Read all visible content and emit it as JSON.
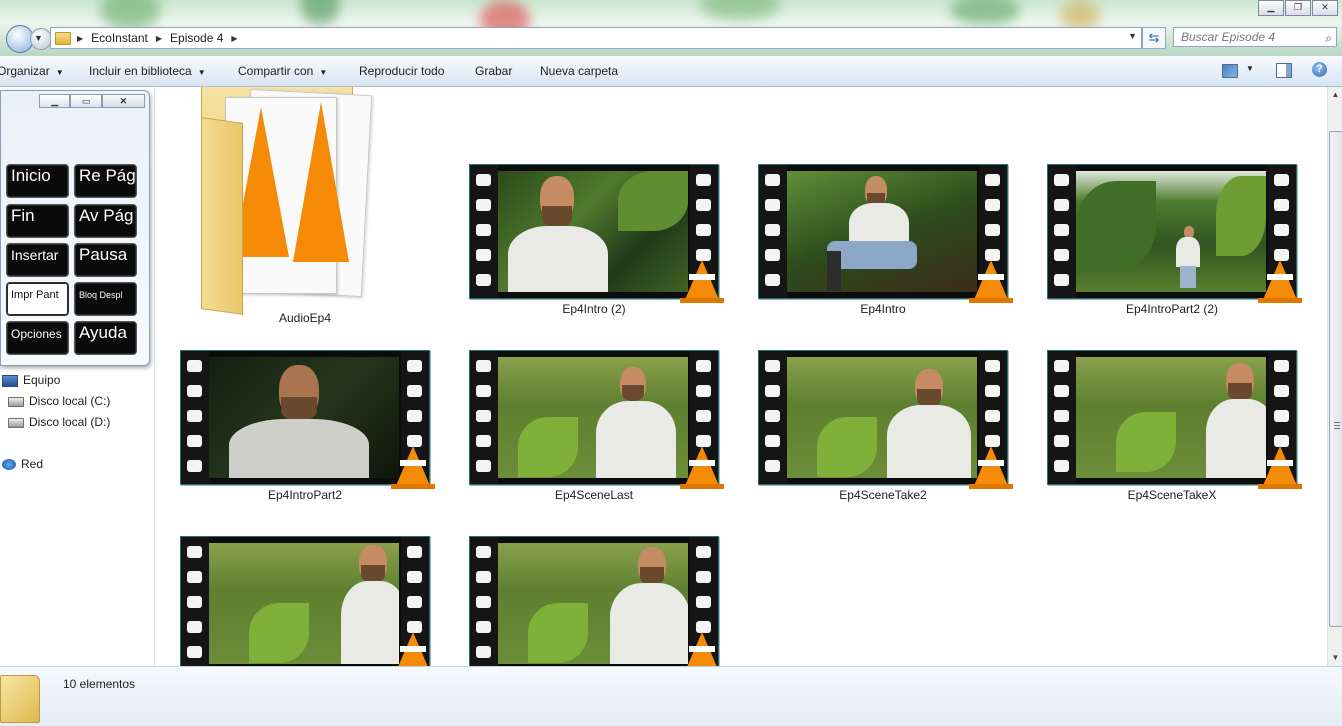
{
  "window": {
    "breadcrumb": [
      "EcoInstant",
      "Episode 4"
    ],
    "search_placeholder": "Buscar Episode 4"
  },
  "toolbar": {
    "organize": "Organizar",
    "include_library": "Incluir en biblioteca",
    "share_with": "Compartir con",
    "play_all": "Reproducir todo",
    "burn": "Grabar",
    "new_folder": "Nueva carpeta"
  },
  "nav": {
    "computer": "Equipo",
    "disk_c": "Disco local (C:)",
    "disk_d": "Disco local (D:)",
    "network": "Red"
  },
  "osk": {
    "keys": [
      "Inicio",
      "Re Pág",
      "Fin",
      "Av Pág",
      "Insertar",
      "Pausa",
      "Impr Pant",
      "Bloq Despl",
      "Opciones",
      "Ayuda"
    ]
  },
  "files": [
    {
      "name": "AudioEp4",
      "type": "folder"
    },
    {
      "name": "Ep4Intro (2)",
      "type": "video"
    },
    {
      "name": "Ep4Intro",
      "type": "video"
    },
    {
      "name": "Ep4IntroPart2 (2)",
      "type": "video"
    },
    {
      "name": "Ep4IntroPart2",
      "type": "video"
    },
    {
      "name": "Ep4SceneLast",
      "type": "video"
    },
    {
      "name": "Ep4SceneTake2",
      "type": "video"
    },
    {
      "name": "Ep4SceneTakeX",
      "type": "video"
    },
    {
      "name": "",
      "type": "video"
    },
    {
      "name": "",
      "type": "video"
    }
  ],
  "status": {
    "count": "10 elementos"
  },
  "colors": {
    "accent": "#f58a06",
    "toolbar_bg": "#e6eef8"
  }
}
